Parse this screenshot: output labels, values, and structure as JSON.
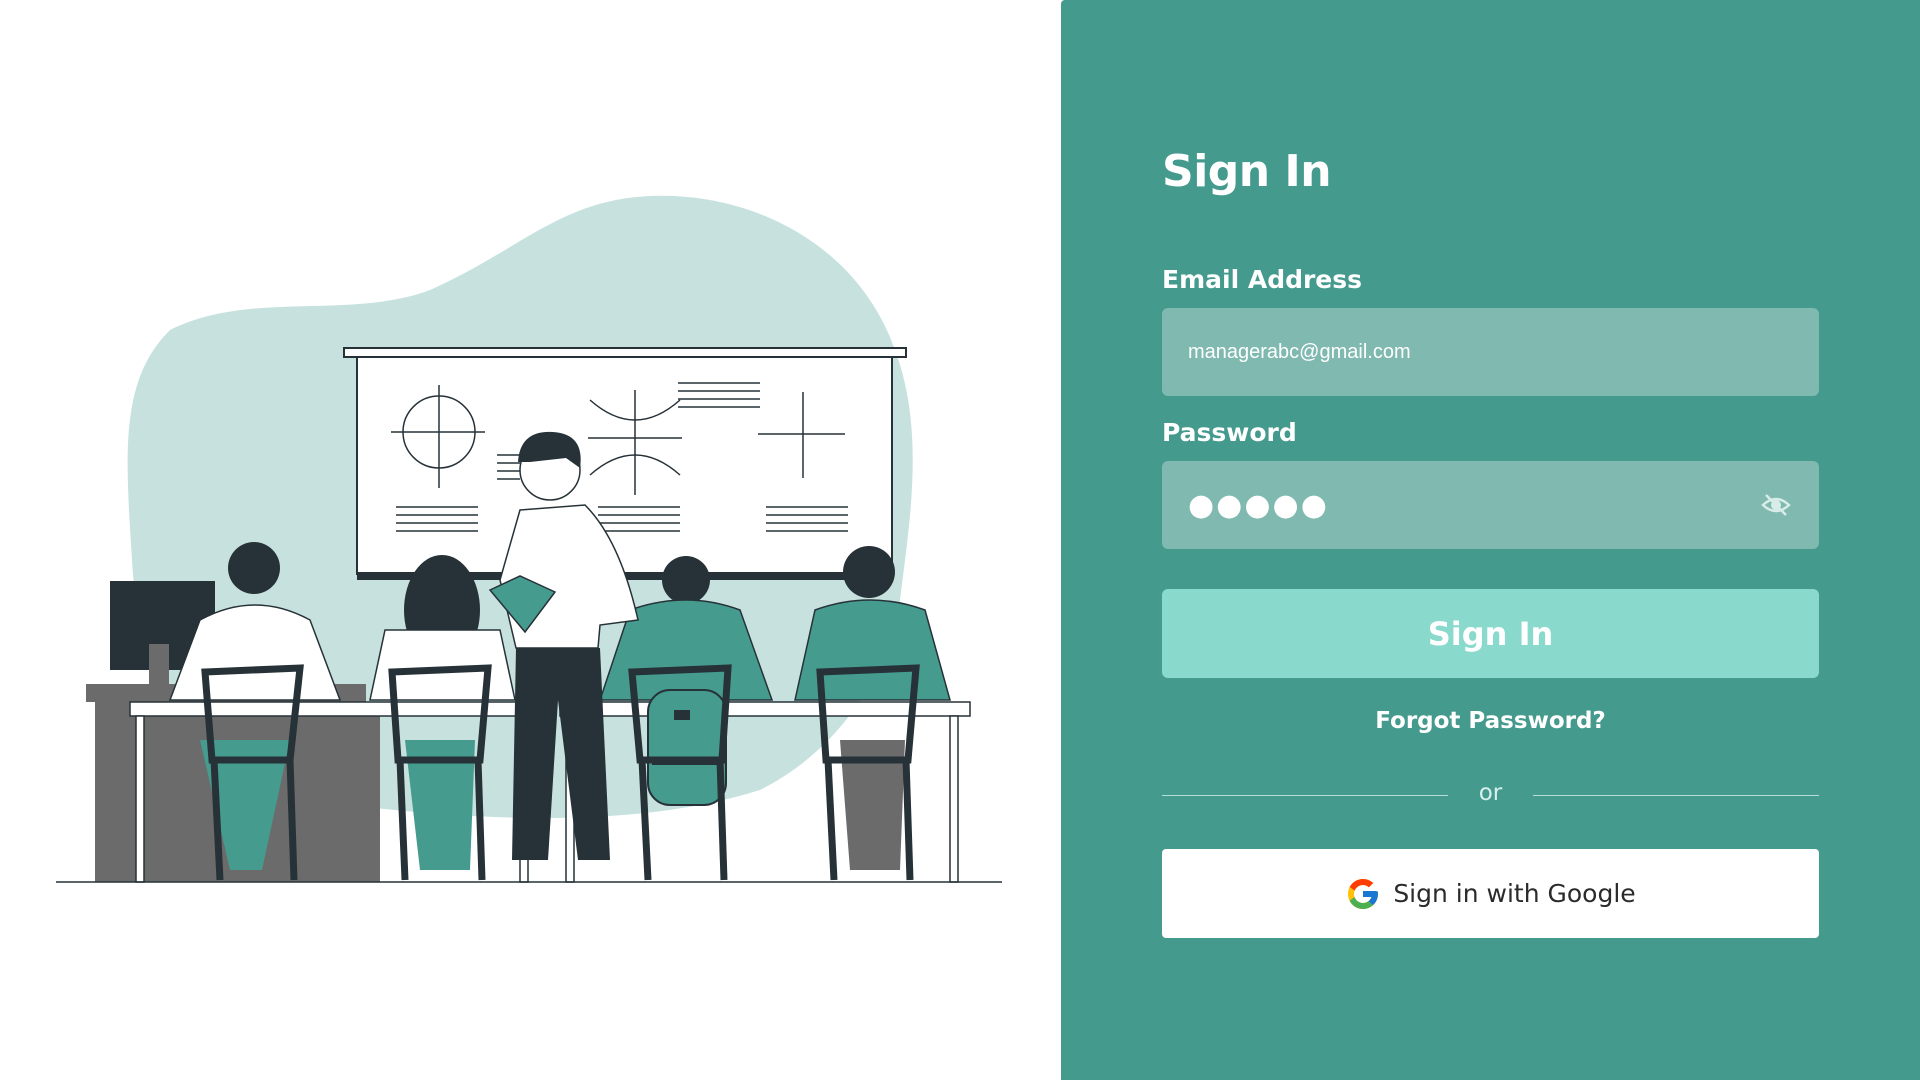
{
  "signin": {
    "title": "Sign In",
    "email_label": "Email Address",
    "email_value": "managerabc@gmail.com",
    "password_label": "Password",
    "password_masked": "●●●●●",
    "submit_label": "Sign In",
    "forgot_label": "Forgot Password?",
    "or_label": "or",
    "google_label": "Sign in with Google"
  },
  "icons": {
    "password_toggle": "eye-off-icon",
    "google": "google-logo-icon"
  },
  "colors": {
    "panel_bg": "#459a8e",
    "input_bg": "#7fb9af",
    "primary_button": "#8ad9cd",
    "illustration_accent": "#469b8f",
    "illustration_blob": "#c7e2de",
    "illustration_dark": "#263238"
  }
}
